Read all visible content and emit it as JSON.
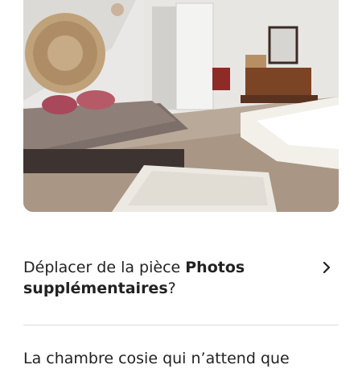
{
  "photo": {
    "icon": "bedroom-photo"
  },
  "move_prompt": {
    "prefix": "Déplacer de la pièce ",
    "room_bold": "Photos supplémentaires",
    "suffix": "?",
    "chevron_icon": "chevron-right-icon"
  },
  "caption": {
    "text": "La chambre cosie qui n’attend que"
  },
  "colors": {
    "text": "#222222",
    "divider": "#dddddd"
  }
}
